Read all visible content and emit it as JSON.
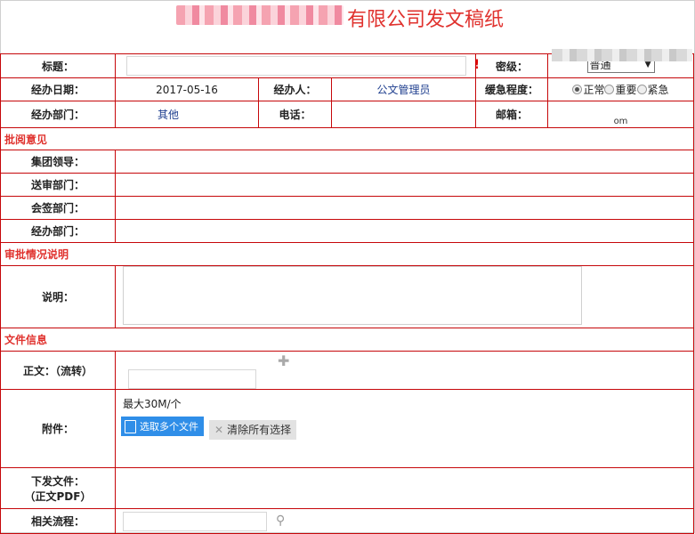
{
  "header": {
    "title": "有限公司发文稿纸"
  },
  "form": {
    "title_label": "标题：",
    "required_mark": "!",
    "secret_label": "密级：",
    "secret_value": "普通",
    "date_label": "经办日期：",
    "date_value": "2017-05-16",
    "handler_label": "经办人：",
    "handler_value": "公文管理员",
    "urgency_label": "缓急程度：",
    "urgency_options": [
      "正常",
      "重要",
      "紧急"
    ],
    "urgency_selected": "正常",
    "dept_label": "经办部门：",
    "dept_value": "其他",
    "phone_label": "电话：",
    "email_label": "邮箱：",
    "email_tail": "om"
  },
  "review": {
    "section_title": "批阅意见",
    "rows": [
      "集团领导：",
      "送审部门：",
      "会签部门：",
      "经办部门："
    ]
  },
  "approval": {
    "section_title": "审批情况说明",
    "note_label": "说明："
  },
  "files": {
    "section_title": "文件信息",
    "body_label": "正文：（流转）",
    "attachment_label": "附件：",
    "attachment_hint": "最大30M/个",
    "select_files_button": "选取多个文件",
    "clear_button": "清除所有选择",
    "issued_label_1": "下发文件：",
    "issued_label_2": "（正文PDF）",
    "related_label": "相关流程："
  }
}
